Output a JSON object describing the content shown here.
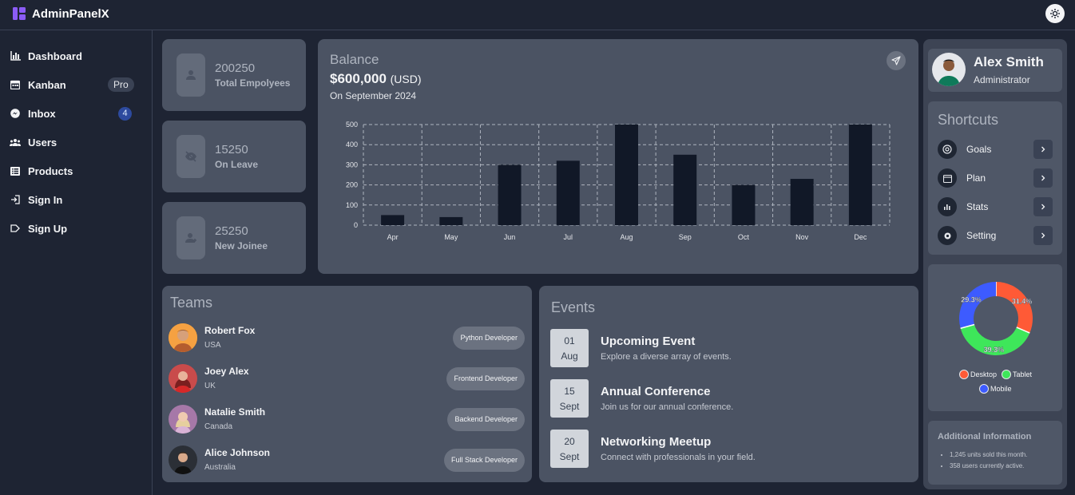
{
  "app": {
    "brand": "AdminPanelX"
  },
  "sidebar": {
    "items": [
      {
        "label": "Dashboard",
        "icon": "bar-chart-icon"
      },
      {
        "label": "Kanban",
        "icon": "calendar-icon",
        "badge": "Pro"
      },
      {
        "label": "Inbox",
        "icon": "messenger-icon",
        "badge": "4"
      },
      {
        "label": "Users",
        "icon": "users-icon"
      },
      {
        "label": "Products",
        "icon": "list-icon"
      },
      {
        "label": "Sign In",
        "icon": "sign-in-icon"
      },
      {
        "label": "Sign Up",
        "icon": "sign-up-icon"
      }
    ]
  },
  "stats": [
    {
      "value": "200250",
      "label": "Total Empolyees",
      "icon": "user-icon"
    },
    {
      "value": "15250",
      "label": "On Leave",
      "icon": "eye-slash-icon"
    },
    {
      "value": "25250",
      "label": "New Joinee",
      "icon": "user-plus-icon"
    }
  ],
  "balance": {
    "title": "Balance",
    "amount": "$600,000",
    "currency": "(USD)",
    "date": "On September 2024"
  },
  "chart_data": {
    "type": "bar",
    "categories": [
      "Apr",
      "May",
      "Jun",
      "Jul",
      "Aug",
      "Sep",
      "Oct",
      "Nov",
      "Dec"
    ],
    "values": [
      50,
      40,
      300,
      320,
      500,
      350,
      200,
      230,
      500
    ],
    "yticks": [
      0,
      100,
      200,
      300,
      400,
      500
    ],
    "ylim": [
      0,
      500
    ],
    "grid": true,
    "title": "",
    "xlabel": "",
    "ylabel": "",
    "bar_color": "#111827"
  },
  "teams": {
    "title": "Teams",
    "members": [
      {
        "name": "Robert Fox",
        "location": "USA",
        "role": "Python Developer"
      },
      {
        "name": "Joey Alex",
        "location": "UK",
        "role": "Frontend Developer"
      },
      {
        "name": "Natalie Smith",
        "location": "Canada",
        "role": "Backend Developer"
      },
      {
        "name": "Alice Johnson",
        "location": "Australia",
        "role": "Full Stack Developer"
      }
    ]
  },
  "events": {
    "title": "Events",
    "items": [
      {
        "day": "01",
        "month": "Aug",
        "title": "Upcoming Event",
        "desc": "Explore a diverse array of events."
      },
      {
        "day": "15",
        "month": "Sept",
        "title": "Annual Conference",
        "desc": "Join us for our annual conference."
      },
      {
        "day": "20",
        "month": "Sept",
        "title": "Networking Meetup",
        "desc": "Connect with professionals in your field."
      }
    ]
  },
  "profile": {
    "name": "Alex Smith",
    "role": "Administrator"
  },
  "shortcuts": {
    "title": "Shortcuts",
    "items": [
      {
        "label": "Goals",
        "icon": "target-icon"
      },
      {
        "label": "Plan",
        "icon": "calendar-icon"
      },
      {
        "label": "Stats",
        "icon": "chart-icon"
      },
      {
        "label": "Setting",
        "icon": "gear-icon"
      }
    ]
  },
  "devices": {
    "segments": [
      {
        "name": "Desktop",
        "value": 31.4,
        "label": "31.4%",
        "color": "#ff5a36"
      },
      {
        "name": "Tablet",
        "value": 39.3,
        "label": "39.3%",
        "color": "#3ee65a"
      },
      {
        "name": "Mobile",
        "value": 29.3,
        "label": "29.3%",
        "color": "#3d5bff"
      }
    ]
  },
  "info": {
    "title": "Additional Information",
    "lines": [
      "1,245 units sold this month.",
      "358 users currently active."
    ]
  }
}
